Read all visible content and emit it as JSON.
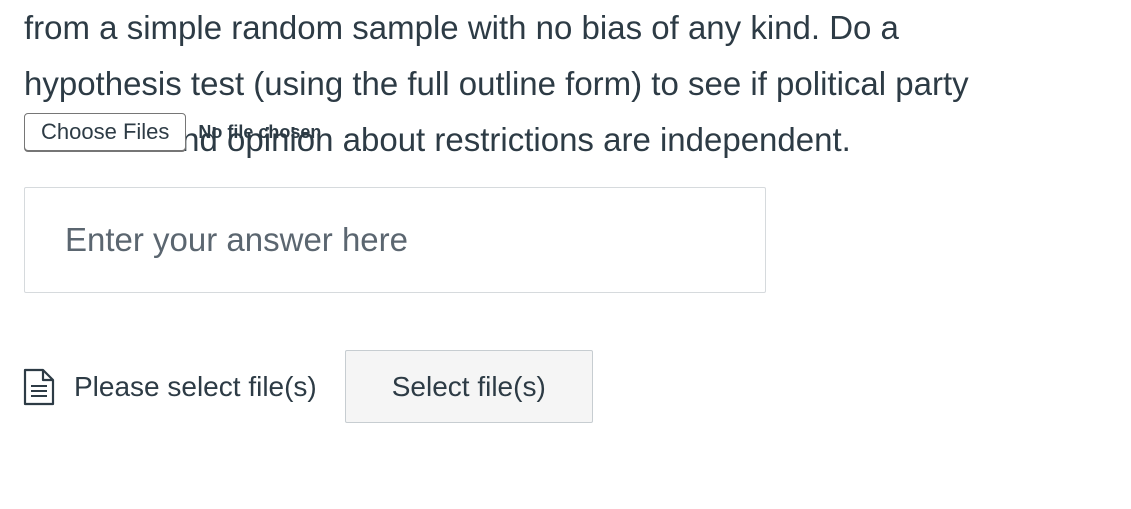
{
  "question": {
    "lines": [
      "from a simple random sample with no bias of any kind. Do a",
      "hypothesis test (using the full outline form) to see if political party",
      "affiliation and opinion about restrictions are independent."
    ]
  },
  "file_input": {
    "button_label": "Choose Files",
    "status_label": "No file chosen"
  },
  "answer": {
    "placeholder": "Enter your answer here",
    "value": ""
  },
  "upload": {
    "icon": "document-icon",
    "prompt": "Please select file(s)",
    "button_label": "Select file(s)"
  }
}
